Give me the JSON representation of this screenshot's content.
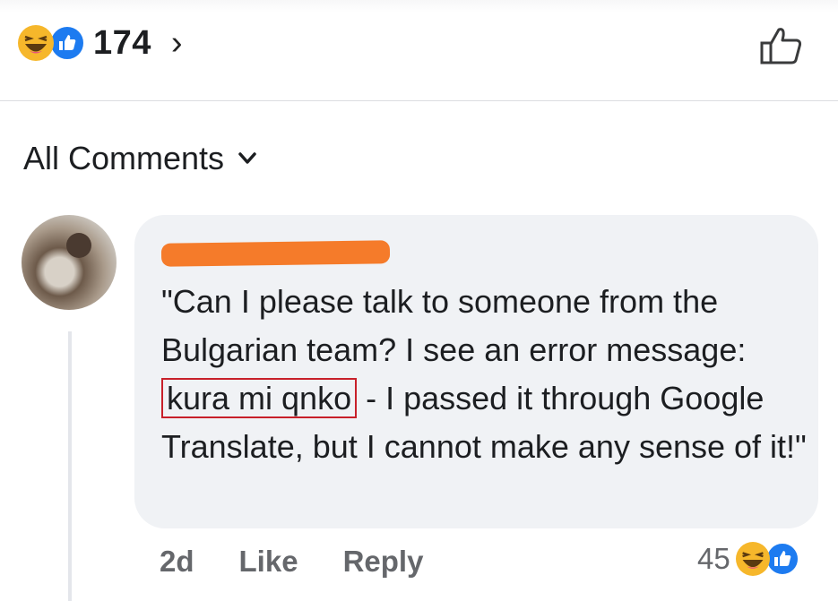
{
  "post": {
    "reaction_count": "174",
    "chevron": "›",
    "reactions": [
      "haha-icon",
      "like-icon"
    ]
  },
  "comments_header": {
    "label": "All Comments"
  },
  "comment": {
    "text_before": "\"Can I please talk to someone from the Bulgarian team? I see an error message: ",
    "highlighted": "kura mi qnko",
    "text_after": " - I passed it through Google Translate, but I cannot make any sense of it!\"",
    "time": "2d",
    "like_label": "Like",
    "reply_label": "Reply",
    "reaction_count": "45"
  },
  "colors": {
    "like_blue": "#1d7bf0",
    "haha_yellow": "#f6b72b",
    "bubble_bg": "#f0f2f5",
    "highlight_border": "#c8202a",
    "redaction": "#f57b2a"
  }
}
